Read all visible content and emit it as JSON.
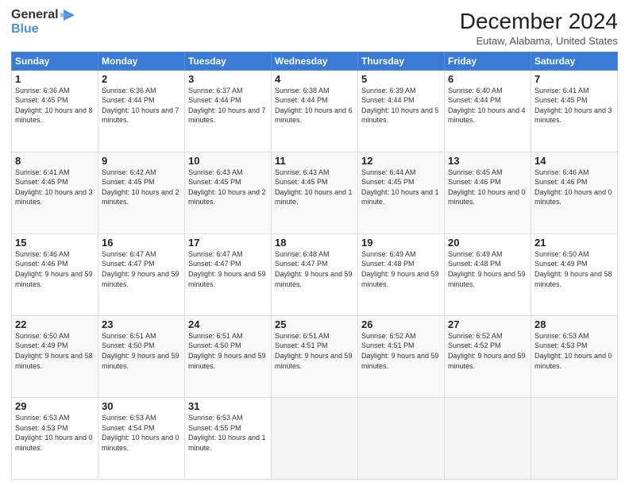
{
  "header": {
    "logo_line1": "General",
    "logo_line2": "Blue",
    "title": "December 2024",
    "subtitle": "Eutaw, Alabama, United States"
  },
  "days_of_week": [
    "Sunday",
    "Monday",
    "Tuesday",
    "Wednesday",
    "Thursday",
    "Friday",
    "Saturday"
  ],
  "weeks": [
    [
      {
        "day": 1,
        "sunrise": "6:36 AM",
        "sunset": "4:45 PM",
        "daylight": "10 hours and 8 minutes."
      },
      {
        "day": 2,
        "sunrise": "6:36 AM",
        "sunset": "4:44 PM",
        "daylight": "10 hours and 7 minutes."
      },
      {
        "day": 3,
        "sunrise": "6:37 AM",
        "sunset": "4:44 PM",
        "daylight": "10 hours and 7 minutes."
      },
      {
        "day": 4,
        "sunrise": "6:38 AM",
        "sunset": "4:44 PM",
        "daylight": "10 hours and 6 minutes."
      },
      {
        "day": 5,
        "sunrise": "6:39 AM",
        "sunset": "4:44 PM",
        "daylight": "10 hours and 5 minutes."
      },
      {
        "day": 6,
        "sunrise": "6:40 AM",
        "sunset": "4:44 PM",
        "daylight": "10 hours and 4 minutes."
      },
      {
        "day": 7,
        "sunrise": "6:41 AM",
        "sunset": "4:45 PM",
        "daylight": "10 hours and 3 minutes."
      }
    ],
    [
      {
        "day": 8,
        "sunrise": "6:41 AM",
        "sunset": "4:45 PM",
        "daylight": "10 hours and 3 minutes."
      },
      {
        "day": 9,
        "sunrise": "6:42 AM",
        "sunset": "4:45 PM",
        "daylight": "10 hours and 2 minutes."
      },
      {
        "day": 10,
        "sunrise": "6:43 AM",
        "sunset": "4:45 PM",
        "daylight": "10 hours and 2 minutes."
      },
      {
        "day": 11,
        "sunrise": "6:43 AM",
        "sunset": "4:45 PM",
        "daylight": "10 hours and 1 minute."
      },
      {
        "day": 12,
        "sunrise": "6:44 AM",
        "sunset": "4:45 PM",
        "daylight": "10 hours and 1 minute."
      },
      {
        "day": 13,
        "sunrise": "6:45 AM",
        "sunset": "4:46 PM",
        "daylight": "10 hours and 0 minutes."
      },
      {
        "day": 14,
        "sunrise": "6:46 AM",
        "sunset": "4:46 PM",
        "daylight": "10 hours and 0 minutes."
      }
    ],
    [
      {
        "day": 15,
        "sunrise": "6:46 AM",
        "sunset": "4:46 PM",
        "daylight": "9 hours and 59 minutes."
      },
      {
        "day": 16,
        "sunrise": "6:47 AM",
        "sunset": "4:47 PM",
        "daylight": "9 hours and 59 minutes."
      },
      {
        "day": 17,
        "sunrise": "6:47 AM",
        "sunset": "4:47 PM",
        "daylight": "9 hours and 59 minutes."
      },
      {
        "day": 18,
        "sunrise": "6:48 AM",
        "sunset": "4:47 PM",
        "daylight": "9 hours and 59 minutes."
      },
      {
        "day": 19,
        "sunrise": "6:49 AM",
        "sunset": "4:48 PM",
        "daylight": "9 hours and 59 minutes."
      },
      {
        "day": 20,
        "sunrise": "6:49 AM",
        "sunset": "4:48 PM",
        "daylight": "9 hours and 59 minutes."
      },
      {
        "day": 21,
        "sunrise": "6:50 AM",
        "sunset": "4:49 PM",
        "daylight": "9 hours and 58 minutes."
      }
    ],
    [
      {
        "day": 22,
        "sunrise": "6:50 AM",
        "sunset": "4:49 PM",
        "daylight": "9 hours and 58 minutes."
      },
      {
        "day": 23,
        "sunrise": "6:51 AM",
        "sunset": "4:50 PM",
        "daylight": "9 hours and 59 minutes."
      },
      {
        "day": 24,
        "sunrise": "6:51 AM",
        "sunset": "4:50 PM",
        "daylight": "9 hours and 59 minutes."
      },
      {
        "day": 25,
        "sunrise": "6:51 AM",
        "sunset": "4:51 PM",
        "daylight": "9 hours and 59 minutes."
      },
      {
        "day": 26,
        "sunrise": "6:52 AM",
        "sunset": "4:51 PM",
        "daylight": "9 hours and 59 minutes."
      },
      {
        "day": 27,
        "sunrise": "6:52 AM",
        "sunset": "4:52 PM",
        "daylight": "9 hours and 59 minutes."
      },
      {
        "day": 28,
        "sunrise": "6:53 AM",
        "sunset": "4:53 PM",
        "daylight": "10 hours and 0 minutes."
      }
    ],
    [
      {
        "day": 29,
        "sunrise": "6:53 AM",
        "sunset": "4:53 PM",
        "daylight": "10 hours and 0 minutes."
      },
      {
        "day": 30,
        "sunrise": "6:53 AM",
        "sunset": "4:54 PM",
        "daylight": "10 hours and 0 minutes."
      },
      {
        "day": 31,
        "sunrise": "6:53 AM",
        "sunset": "4:55 PM",
        "daylight": "10 hours and 1 minute."
      },
      null,
      null,
      null,
      null
    ]
  ]
}
